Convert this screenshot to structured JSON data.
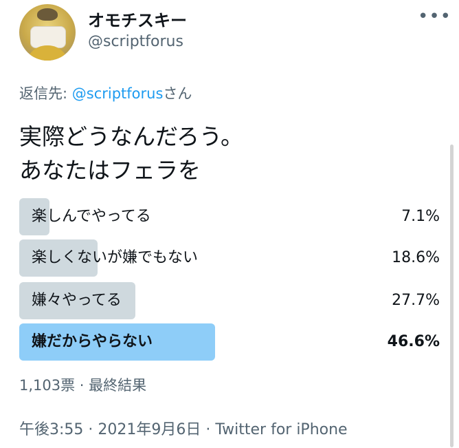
{
  "author": {
    "display_name": "オモチスキー",
    "handle": "@scriptforus"
  },
  "reply": {
    "prefix": "返信先: ",
    "handle": "@scriptforus",
    "suffix": "さん"
  },
  "tweet": {
    "line1": "実際どうなんだろう。",
    "line2": "あなたはフェラを"
  },
  "poll": {
    "options": [
      {
        "label": "楽しんでやってる",
        "percent_text": "7.1%",
        "percent": 7.1,
        "winner": false
      },
      {
        "label": "楽しくないが嫌でもない",
        "percent_text": "18.6%",
        "percent": 18.6,
        "winner": false
      },
      {
        "label": "嫌々やってる",
        "percent_text": "27.7%",
        "percent": 27.7,
        "winner": false
      },
      {
        "label": "嫌だからやらない",
        "percent_text": "46.6%",
        "percent": 46.6,
        "winner": true
      }
    ],
    "meta": "1,103票 · 最終結果"
  },
  "timestamp": "午後3:55 · 2021年9月6日 · Twitter for iPhone",
  "icons": {
    "more": "more-horizontal-icon",
    "avatar": "user-avatar"
  },
  "colors": {
    "link": "#1d9bf0",
    "bar": "#cfd9de",
    "winner_bar": "#8ecdf8",
    "secondary_text": "#536471"
  }
}
